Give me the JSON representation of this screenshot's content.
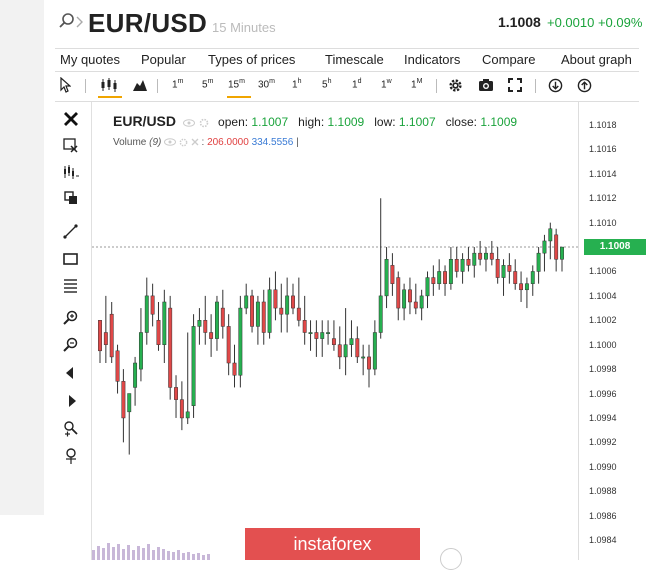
{
  "header": {
    "symbol": "EUR/USD",
    "interval": "15 Minutes",
    "price": "1.1008",
    "change": "+0.0010 +0.09%"
  },
  "menu": [
    "My quotes",
    "Popular",
    "Types of prices",
    "Timescale",
    "Indicators",
    "Compare",
    "About graph"
  ],
  "toolbar": {
    "timeframes": [
      {
        "label": "1",
        "sup": "m"
      },
      {
        "label": "5",
        "sup": "m"
      },
      {
        "label": "15",
        "sup": "m"
      },
      {
        "label": "30",
        "sup": "m"
      },
      {
        "label": "1",
        "sup": "h"
      },
      {
        "label": "5",
        "sup": "h"
      },
      {
        "label": "1",
        "sup": "d"
      },
      {
        "label": "1",
        "sup": "w"
      },
      {
        "label": "1",
        "sup": "M"
      }
    ],
    "active_timeframe": "15m"
  },
  "legend": {
    "symbol": "EUR/USD",
    "open_label": "open:",
    "open": "1.1007",
    "high_label": "high:",
    "high": "1.1009",
    "low_label": "low:",
    "low": "1.1007",
    "close_label": "close:",
    "close": "1.1009",
    "volume_label": "Volume",
    "volume_period": "(9)",
    "volume_sep": ":",
    "volume_value1": "206.0000",
    "volume_value2": "334.5556",
    "volume_tail": "|"
  },
  "watermark": "instaforex",
  "colors": {
    "up": "#26b050",
    "down": "#e04848",
    "accent": "#f0a500",
    "price_tag": "#26b050"
  },
  "chart_data": {
    "type": "candlestick",
    "y_ticks": [
      "1.1018",
      "1.1016",
      "1.1014",
      "1.1012",
      "1.1010",
      "1.1008",
      "1.1006",
      "1.1004",
      "1.1002",
      "1.1000",
      "1.0998",
      "1.0996",
      "1.0994",
      "1.0992",
      "1.0990",
      "1.0988",
      "1.0986",
      "1.0984"
    ],
    "ylim": [
      1.0983,
      1.1019
    ],
    "current_price": 1.1008,
    "current_price_label": "1.1008",
    "candles": [
      [
        1.1002,
        1.1002,
        1.09985,
        1.09995
      ],
      [
        1.1001,
        1.1004,
        1.09985,
        1.1
      ],
      [
        1.10025,
        1.10035,
        1.09985,
        1.0999
      ],
      [
        1.09995,
        1.1,
        1.0996,
        1.0997
      ],
      [
        1.0997,
        1.0998,
        1.0992,
        1.0994
      ],
      [
        1.09945,
        1.0996,
        1.0991,
        1.0996
      ],
      [
        1.09965,
        1.0999,
        1.0995,
        1.09985
      ],
      [
        1.0998,
        1.1003,
        1.0997,
        1.1001
      ],
      [
        1.1001,
        1.10055,
        1.1,
        1.1004
      ],
      [
        1.1004,
        1.1005,
        1.10015,
        1.10025
      ],
      [
        1.1002,
        1.10035,
        1.09995,
        1.1
      ],
      [
        1.1,
        1.10045,
        1.09985,
        1.10035
      ],
      [
        1.1003,
        1.1004,
        1.09955,
        1.09965
      ],
      [
        1.09965,
        1.09975,
        1.0994,
        1.09955
      ],
      [
        1.09955,
        1.0997,
        1.0993,
        1.0994
      ],
      [
        1.0994,
        1.1001,
        1.09935,
        1.09945
      ],
      [
        1.0995,
        1.10025,
        1.0994,
        1.10015
      ],
      [
        1.10015,
        1.1003,
        1.1,
        1.1002
      ],
      [
        1.1002,
        1.1004,
        1.1,
        1.1001
      ],
      [
        1.1001,
        1.10025,
        1.0999,
        1.10005
      ],
      [
        1.10005,
        1.1004,
        1.09995,
        1.10035
      ],
      [
        1.1003,
        1.10045,
        1.10005,
        1.10015
      ],
      [
        1.10015,
        1.10025,
        1.09975,
        1.09985
      ],
      [
        1.09985,
        1.1,
        1.09965,
        1.09975
      ],
      [
        1.09975,
        1.1004,
        1.09965,
        1.1003
      ],
      [
        1.1003,
        1.1005,
        1.10025,
        1.1004
      ],
      [
        1.1004,
        1.10045,
        1.1001,
        1.10015
      ],
      [
        1.10015,
        1.1004,
        1.1,
        1.10035
      ],
      [
        1.10035,
        1.10045,
        1.1,
        1.1001
      ],
      [
        1.1001,
        1.10055,
        1.10005,
        1.10045
      ],
      [
        1.10045,
        1.1006,
        1.1002,
        1.1003
      ],
      [
        1.1003,
        1.1005,
        1.1001,
        1.10025
      ],
      [
        1.10025,
        1.10055,
        1.1001,
        1.1004
      ],
      [
        1.1004,
        1.1005,
        1.10025,
        1.1003
      ],
      [
        1.1003,
        1.10055,
        1.10015,
        1.1002
      ],
      [
        1.1002,
        1.1004,
        1.1,
        1.1001
      ],
      [
        1.1001,
        1.1002,
        1.09995,
        1.1001
      ],
      [
        1.1001,
        1.1002,
        1.0999,
        1.10005
      ],
      [
        1.10005,
        1.1002,
        1.0999,
        1.1001
      ],
      [
        1.1001,
        1.1002,
        1.1,
        1.1001
      ],
      [
        1.10005,
        1.1002,
        1.09995,
        1.1
      ],
      [
        1.1,
        1.10015,
        1.0998,
        1.0999
      ],
      [
        1.0999,
        1.1003,
        1.09975,
        1.1
      ],
      [
        1.1,
        1.1002,
        1.0999,
        1.10005
      ],
      [
        1.10005,
        1.10015,
        1.09985,
        1.0999
      ],
      [
        1.0999,
        1.1,
        1.09975,
        1.0999
      ],
      [
        1.0999,
        1.1,
        1.09965,
        1.0998
      ],
      [
        1.0998,
        1.1002,
        1.09975,
        1.1001
      ],
      [
        1.1001,
        1.1012,
        1.10005,
        1.1004
      ],
      [
        1.1004,
        1.1008,
        1.1003,
        1.1007
      ],
      [
        1.10065,
        1.10075,
        1.1004,
        1.1005
      ],
      [
        1.10055,
        1.1006,
        1.1002,
        1.1003
      ],
      [
        1.1003,
        1.1005,
        1.1002,
        1.10045
      ],
      [
        1.10045,
        1.10055,
        1.10025,
        1.10035
      ],
      [
        1.10035,
        1.1005,
        1.10025,
        1.1003
      ],
      [
        1.1003,
        1.10045,
        1.1002,
        1.1004
      ],
      [
        1.1004,
        1.1006,
        1.1003,
        1.10055
      ],
      [
        1.10055,
        1.10065,
        1.1004,
        1.1005
      ],
      [
        1.1005,
        1.1007,
        1.10045,
        1.1006
      ],
      [
        1.1006,
        1.10065,
        1.1004,
        1.1005
      ],
      [
        1.1005,
        1.1008,
        1.10045,
        1.1007
      ],
      [
        1.1007,
        1.1008,
        1.10055,
        1.1006
      ],
      [
        1.1006,
        1.10075,
        1.1005,
        1.1007
      ],
      [
        1.1007,
        1.1008,
        1.1006,
        1.10065
      ],
      [
        1.10065,
        1.1008,
        1.10055,
        1.10075
      ],
      [
        1.10075,
        1.10085,
        1.10065,
        1.1007
      ],
      [
        1.1007,
        1.1008,
        1.1006,
        1.10075
      ],
      [
        1.10075,
        1.10085,
        1.10065,
        1.1007
      ],
      [
        1.1007,
        1.1008,
        1.1005,
        1.10055
      ],
      [
        1.10055,
        1.1007,
        1.1004,
        1.10065
      ],
      [
        1.10065,
        1.10075,
        1.1005,
        1.1006
      ],
      [
        1.1006,
        1.1007,
        1.10045,
        1.1005
      ],
      [
        1.1005,
        1.1006,
        1.10035,
        1.10045
      ],
      [
        1.10045,
        1.10055,
        1.1003,
        1.1005
      ],
      [
        1.1005,
        1.10065,
        1.1004,
        1.1006
      ],
      [
        1.1006,
        1.1008,
        1.1005,
        1.10075
      ],
      [
        1.10075,
        1.1009,
        1.1006,
        1.10085
      ],
      [
        1.10085,
        1.101,
        1.1007,
        1.10095
      ],
      [
        1.1009,
        1.10095,
        1.1006,
        1.1007
      ],
      [
        1.1007,
        1.1008,
        1.1006,
        1.1008
      ]
    ]
  }
}
